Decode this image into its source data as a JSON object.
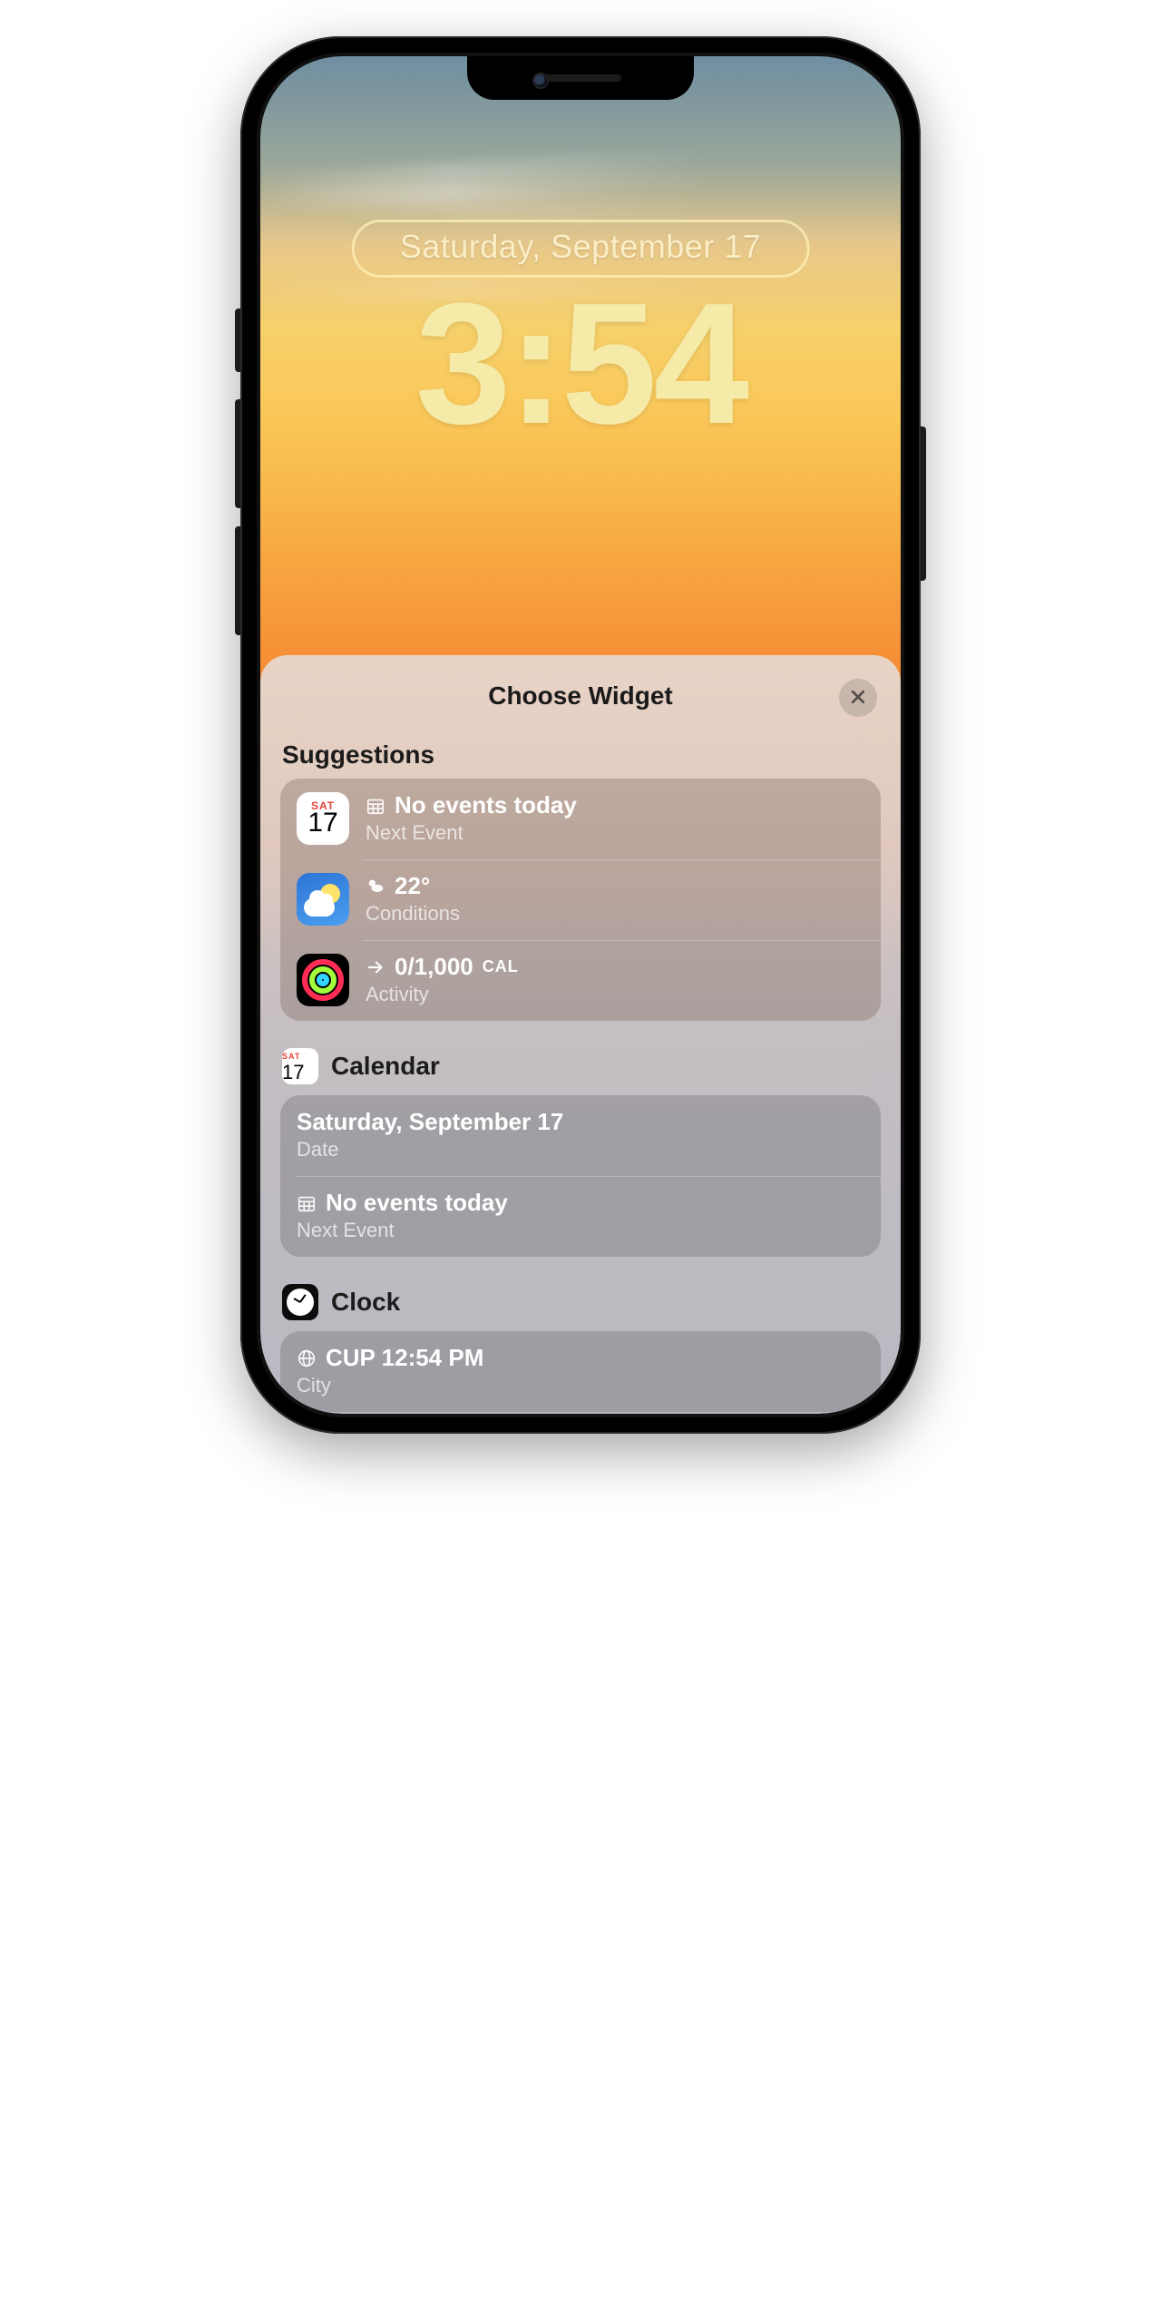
{
  "lockscreen": {
    "date_label": "Saturday, September 17",
    "time_label": "3:54"
  },
  "sheet": {
    "title": "Choose Widget",
    "close_label": "Close"
  },
  "suggestions": {
    "heading": "Suggestions",
    "items": [
      {
        "app": "Calendar",
        "icon": {
          "dow": "SAT",
          "dom": "17"
        },
        "title": "No events today",
        "subtitle": "Next Event",
        "mini_icon": "calendar-grid"
      },
      {
        "app": "Weather",
        "icon": {},
        "title": "22°",
        "subtitle": "Conditions",
        "mini_icon": "partly-cloudy"
      },
      {
        "app": "Activity",
        "icon": {},
        "title_prefix": "→ ",
        "title_value": "0/1,000",
        "title_unit": "CAL",
        "subtitle": "Activity",
        "mini_icon": "arrow-right"
      }
    ]
  },
  "calendar": {
    "heading": "Calendar",
    "icon": {
      "dow": "SAT",
      "dom": "17"
    },
    "items": [
      {
        "title": "Saturday, September 17",
        "subtitle": "Date",
        "mini_icon": null
      },
      {
        "title": "No events today",
        "subtitle": "Next Event",
        "mini_icon": "calendar-grid"
      }
    ]
  },
  "clock": {
    "heading": "Clock",
    "items": [
      {
        "title": "CUP 12:54 PM",
        "subtitle": "City",
        "mini_icon": "globe"
      }
    ]
  }
}
